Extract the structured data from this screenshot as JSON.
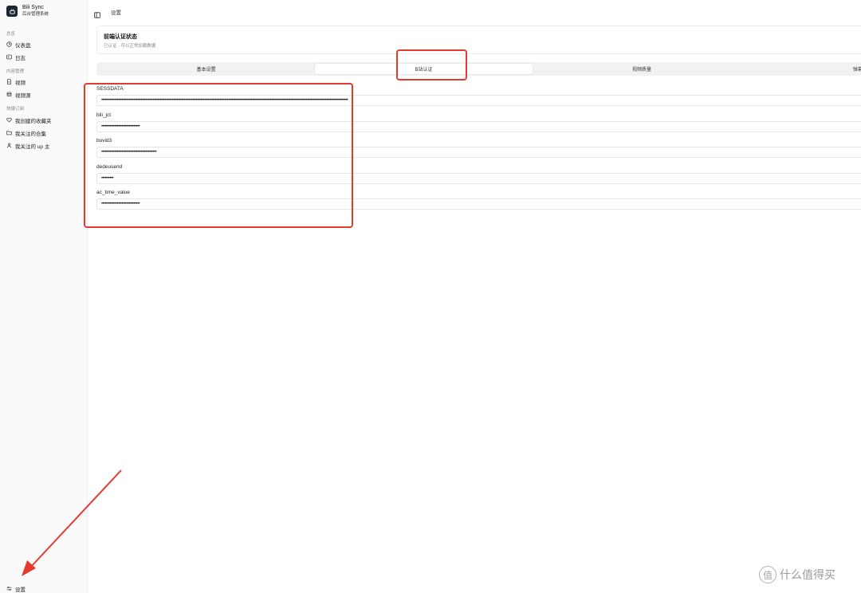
{
  "brand": {
    "name": "Bili Sync",
    "subtitle": "后台管理系统"
  },
  "sidebar": {
    "groups": [
      {
        "label": "总览",
        "items": [
          {
            "label": "仪表盘",
            "icon": "gauge-icon"
          },
          {
            "label": "日志",
            "icon": "terminal-icon"
          }
        ]
      },
      {
        "label": "内容管理",
        "items": [
          {
            "label": "视频",
            "icon": "file-video-icon"
          },
          {
            "label": "视频源",
            "icon": "database-icon"
          }
        ]
      },
      {
        "label": "快捷订阅",
        "items": [
          {
            "label": "我创建的收藏夹",
            "icon": "heart-icon"
          },
          {
            "label": "我关注的合集",
            "icon": "folder-icon"
          },
          {
            "label": "我关注的 up 主",
            "icon": "user-icon"
          }
        ]
      }
    ],
    "footer": {
      "label": "设置",
      "icon": "settings-sliders-icon"
    }
  },
  "header": {
    "breadcrumb": "设置"
  },
  "auth_card": {
    "title": "前端认证状态",
    "subtitle": "已认证 - 可以正常加载数据"
  },
  "tabs": [
    {
      "label": "基本设置",
      "active": false
    },
    {
      "label": "B站认证",
      "active": true
    },
    {
      "label": "视频质量",
      "active": false
    },
    {
      "label": "弹幕设",
      "active": false
    }
  ],
  "fields": [
    {
      "label": "SESSDATA",
      "value": "••••••••••••••••••••••••••••••••••••••••••••••••••••••••••••••••••••••••••••••••••••••••••••••••••••••••••••••••••••••••••••••••••••••••••••••••••••••••••••••••••••••••••••••••••••••••••••••••••••••••••••••"
    },
    {
      "label": "bili_jct",
      "value": "••••••••••••••••••••••••••••••••"
    },
    {
      "label": "buvid3",
      "value": "••••••••••••••••••••••••••••••••••••••••••••••"
    },
    {
      "label": "dedeuserid",
      "value": "••••••••••"
    },
    {
      "label": "ac_time_value",
      "value": "••••••••••••••••••••••••••••••••"
    }
  ],
  "watermark": {
    "text": "什么值得买",
    "icon_glyph": "值"
  },
  "colors": {
    "annotation": "#e53a30",
    "sidebar_bg": "#fafafa",
    "brand_logo": "#1f2433"
  }
}
